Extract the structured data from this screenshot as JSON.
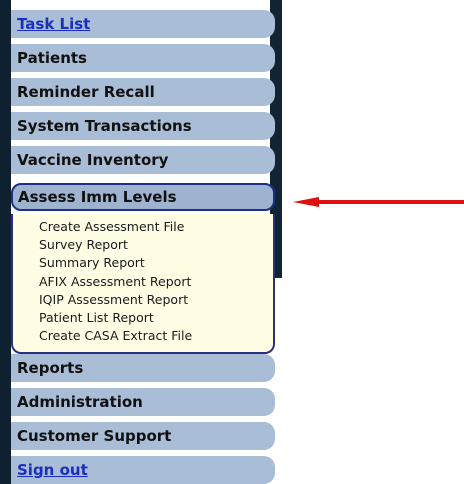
{
  "nav": {
    "items": [
      {
        "label": "Task List"
      },
      {
        "label": "Patients"
      },
      {
        "label": "Reminder Recall"
      },
      {
        "label": "System Transactions"
      },
      {
        "label": "Vaccine Inventory"
      },
      {
        "label": "Assess Imm Levels"
      },
      {
        "label": "Reports"
      },
      {
        "label": "Administration"
      },
      {
        "label": "Customer Support"
      },
      {
        "label": "Sign out"
      }
    ],
    "submenu": [
      {
        "label": "Create Assessment File"
      },
      {
        "label": "Survey Report"
      },
      {
        "label": "Summary Report"
      },
      {
        "label": "AFIX Assessment Report"
      },
      {
        "label": "IQIP Assessment Report"
      },
      {
        "label": "Patient List Report"
      },
      {
        "label": "Create CASA Extract File"
      }
    ]
  },
  "annotation": {
    "arrow_color": "#e01010"
  }
}
